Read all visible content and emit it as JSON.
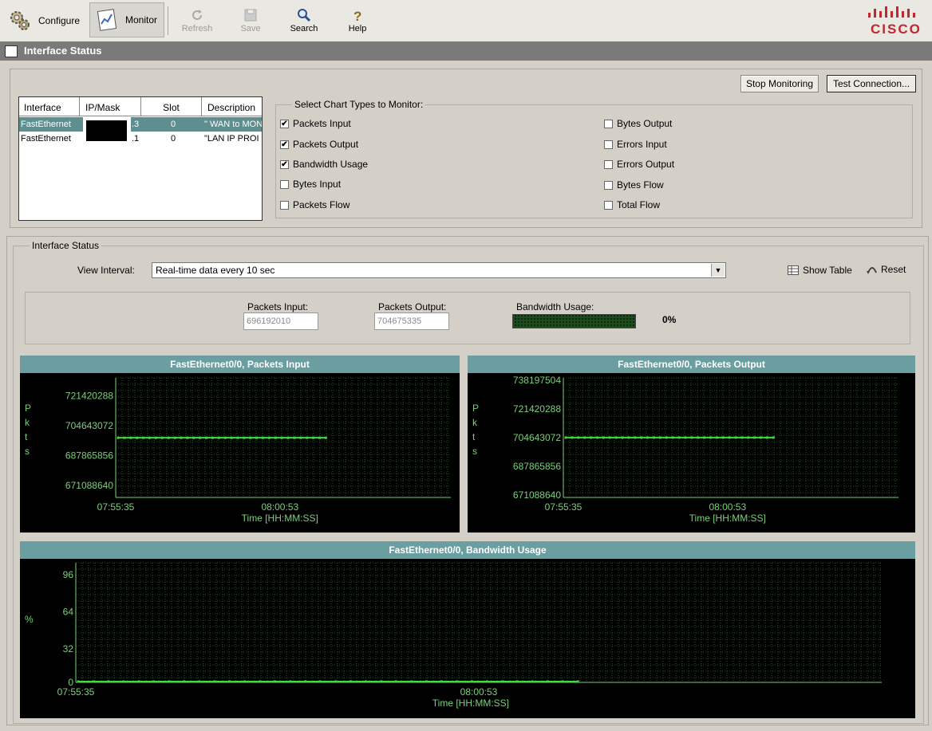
{
  "toolbar": {
    "configure": "Configure",
    "monitor": "Monitor",
    "refresh": "Refresh",
    "save": "Save",
    "search": "Search",
    "help": "Help",
    "brand": "CISCO"
  },
  "window": {
    "title": "Interface Status"
  },
  "buttons": {
    "stop_monitoring": "Stop Monitoring",
    "test_connection": "Test Connection..."
  },
  "interface_table": {
    "columns": [
      "Interface",
      "IP/Mask",
      "Slot",
      "Description"
    ],
    "rows": [
      {
        "interface": "FastEthernet",
        "ip_suffix": ".3",
        "slot": "0",
        "description": "\" WAN to MON"
      },
      {
        "interface": "FastEthernet",
        "ip_suffix": ".1",
        "slot": "0",
        "description": "\"LAN IP PROI"
      }
    ]
  },
  "chart_types": {
    "legend": "Select Chart Types to Monitor:",
    "left": [
      {
        "label": "Packets Input",
        "checked": true
      },
      {
        "label": "Packets Output",
        "checked": true
      },
      {
        "label": "Bandwidth Usage",
        "checked": true
      },
      {
        "label": "Bytes Input",
        "checked": false
      },
      {
        "label": "Packets Flow",
        "checked": false
      }
    ],
    "right": [
      {
        "label": "Bytes Output",
        "checked": false
      },
      {
        "label": "Errors Input",
        "checked": false
      },
      {
        "label": "Errors Output",
        "checked": false
      },
      {
        "label": "Bytes Flow",
        "checked": false
      },
      {
        "label": "Total Flow",
        "checked": false
      }
    ]
  },
  "interface_status": {
    "legend": "Interface Status",
    "view_interval_label": "View Interval:",
    "view_interval_value": "Real-time data every 10 sec",
    "show_table": "Show Table",
    "reset": "Reset",
    "packets_input_label": "Packets Input:",
    "packets_input_value": "696192010",
    "packets_output_label": "Packets Output:",
    "packets_output_value": "704675335",
    "bandwidth_label": "Bandwidth Usage:",
    "bandwidth_value": "0%",
    "bandwidth_fraction": 0
  },
  "colors": {
    "chart_header": "#6a9ea0",
    "plot_line": "#3fdc3f",
    "grid": "#1f5a1f",
    "axis_text": "#7ad07a"
  },
  "chart_data": [
    {
      "type": "line",
      "title": "FastEthernet0/0, Packets Input",
      "ylabel": "Pkts",
      "xlabel": "Time [HH:MM:SS]",
      "yticks": [
        "721420288",
        "704643072",
        "687865856",
        "671088640"
      ],
      "ylim": [
        671088640,
        721420288
      ],
      "xticks": [
        "07:55:35",
        "08:00:53"
      ],
      "series": [
        {
          "values": [
            696192010,
            696192010,
            696192010,
            696192010,
            696192010,
            696192010,
            696192010,
            696192010,
            696192010,
            696192010,
            696192010,
            696192010,
            696192010,
            696192010,
            696192010,
            696192010,
            696192010,
            696192010,
            696192010,
            696192010,
            696192010,
            696192010,
            696192010,
            696192010,
            696192010,
            696192010,
            696192010,
            696192010,
            696192010,
            696192010,
            696192010,
            696192010,
            696192010,
            696192010
          ]
        }
      ]
    },
    {
      "type": "line",
      "title": "FastEthernet0/0, Packets Output",
      "ylabel": "Pkts",
      "xlabel": "Time [HH:MM:SS]",
      "yticks": [
        "738197504",
        "721420288",
        "704643072",
        "687865856",
        "671088640"
      ],
      "ylim": [
        671088640,
        738197504
      ],
      "xticks": [
        "07:55:35",
        "08:00:53"
      ],
      "series": [
        {
          "values": [
            704675335,
            704675335,
            704675335,
            704675335,
            704675335,
            704675335,
            704675335,
            704675335,
            704675335,
            704675335,
            704675335,
            704675335,
            704675335,
            704675335,
            704675335,
            704675335,
            704675335,
            704675335,
            704675335,
            704675335,
            704675335,
            704675335,
            704675335,
            704675335,
            704675335,
            704675335,
            704675335,
            704675335,
            704675335,
            704675335,
            704675335,
            704675335,
            704675335,
            704675335
          ]
        }
      ]
    },
    {
      "type": "line",
      "title": "FastEthernet0/0, Bandwidth Usage",
      "ylabel": "%",
      "xlabel": "Time [HH:MM:SS]",
      "yticks": [
        "96",
        "64",
        "32",
        "0"
      ],
      "ylim": [
        0,
        100
      ],
      "xticks": [
        "07:55:35",
        "08:00:53"
      ],
      "series": [
        {
          "values": [
            0,
            0,
            0,
            0,
            0,
            0,
            0,
            0,
            0,
            0,
            0,
            0,
            0,
            0,
            0,
            0,
            0,
            0,
            0,
            0,
            0,
            0,
            0,
            0,
            0,
            0,
            0,
            0,
            0,
            0,
            0,
            0,
            0,
            0
          ]
        }
      ]
    }
  ]
}
